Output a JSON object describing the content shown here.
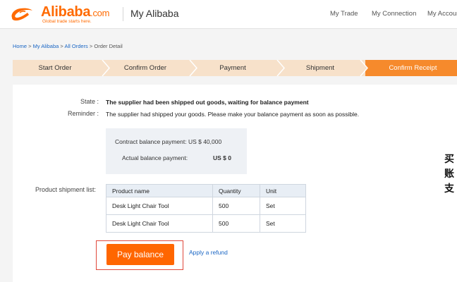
{
  "header": {
    "logo_word": "Alibaba",
    "logo_tld": ".com",
    "logo_tagline": "Global trade starts here.",
    "title": "My Alibaba",
    "nav": [
      "My Trade",
      "My Connection",
      "My Account"
    ]
  },
  "breadcrumb": {
    "items": [
      "Home",
      "My Alibaba",
      "All Orders"
    ],
    "separator": ">",
    "current": "Order Detail"
  },
  "steps": {
    "items": [
      "Start Order",
      "Confirm Order",
      "Payment",
      "Shipment",
      "Confirm Receipt"
    ],
    "active_index": 4,
    "colors": {
      "inactive": "#f7e1ca",
      "active": "#f68a2c"
    }
  },
  "order": {
    "state_label": "State :",
    "state_value": "The supplier had been shipped out goods, waiting for balance payment",
    "reminder_label": "Reminder :",
    "reminder_value": "The supplier had shipped your goods. Please make your balance payment as soon as possible.",
    "contract_balance": "Contract balance payment: US $ 40,000",
    "actual_label": "Actual balance payment:",
    "actual_value": "US $ 0"
  },
  "shipment": {
    "label": "Product shipment list:",
    "columns": [
      "Product name",
      "Quantity",
      "Unit"
    ],
    "rows": [
      [
        "Desk Light Chair Tool",
        "500",
        "Set"
      ],
      [
        "Desk Light Chair Tool",
        "500",
        "Set"
      ]
    ]
  },
  "actions": {
    "pay_label": "Pay balance",
    "refund_label": "Apply a refund"
  },
  "overlay_text": [
    "买",
    "账",
    "支"
  ],
  "colors": {
    "brand_orange": "#ff6a00",
    "link_blue": "#1a66c4",
    "highlight_red": "#e0483b"
  }
}
